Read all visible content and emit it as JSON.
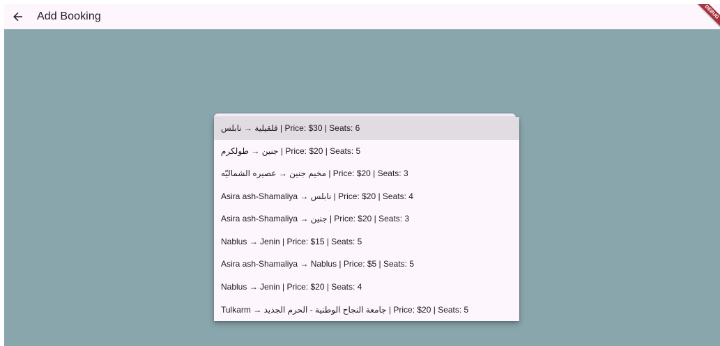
{
  "appbar": {
    "title": "Add Booking",
    "back_icon": "arrow-back-icon",
    "debug_banner": "DEBUG"
  },
  "menu": {
    "highlighted_index": 0,
    "items": [
      {
        "label": "قلقيلية → نابلس | Price: $30 | Seats: 6"
      },
      {
        "label": "جنين → طولكرم | Price: $20 | Seats: 5"
      },
      {
        "label": "مخيم جنين → عصيره الشماليّه | Price: $20 | Seats: 3"
      },
      {
        "label": "Asira ash-Shamaliya → نابلس | Price: $20 | Seats: 4"
      },
      {
        "label": "Asira ash-Shamaliya → جنين | Price: $20 | Seats: 3"
      },
      {
        "label": "Nablus → Jenin | Price: $15 | Seats: 5"
      },
      {
        "label": "Asira ash-Shamaliya → Nablus | Price: $5 | Seats: 5"
      },
      {
        "label": "Nablus → Jenin | Price: $20 | Seats: 4"
      },
      {
        "label": "Tulkarm → جامعة النجاح الوطنية - الحرم الجديد | Price: $20 | Seats: 5"
      }
    ]
  },
  "colors": {
    "background": "#8aa6ad",
    "appbar": "#fdf6fd",
    "menu": "#fdf6fd",
    "highlight": "#e0dce1",
    "debug_ribbon": "#a8313f"
  }
}
